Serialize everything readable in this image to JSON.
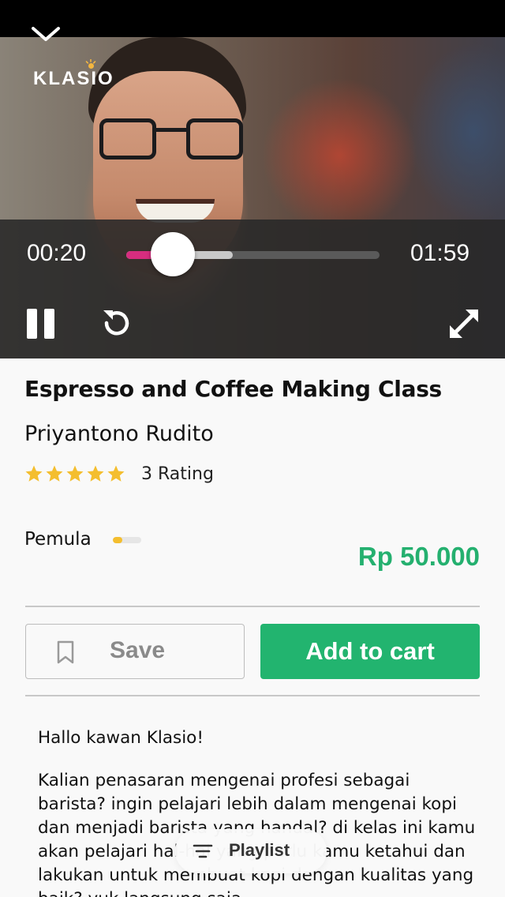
{
  "player": {
    "current_time": "00:20",
    "duration": "01:59",
    "played_fraction": 0.17,
    "buffered_fraction": 0.42,
    "logo_text": "KLASIO",
    "progress_color": "#d62d7f"
  },
  "course": {
    "title": "Espresso and Coffee Making Class",
    "instructor": "Priyantono Rudito",
    "stars": 5,
    "rating_text": "3 Rating",
    "level": "Pemula",
    "level_fraction": 0.33,
    "price": "Rp 50.000"
  },
  "actions": {
    "save_label": "Save",
    "cart_label": "Add to cart"
  },
  "description": {
    "greeting": "Hallo kawan Klasio!",
    "body": "Kalian penasaran mengenai profesi sebagai barista? ingin pelajari lebih dalam mengenai kopi dan menjadi barista yang handal? di kelas ini kamu akan pelajari hal-hal yang perlu kamu ketahui dan lakukan untuk membuat kopi dengan kualitas yang baik? yuk langsung saja"
  },
  "playlist": {
    "label": "Playlist"
  },
  "colors": {
    "accent_green": "#22b46f",
    "price_green": "#24b06f",
    "star": "#f4be2e"
  }
}
